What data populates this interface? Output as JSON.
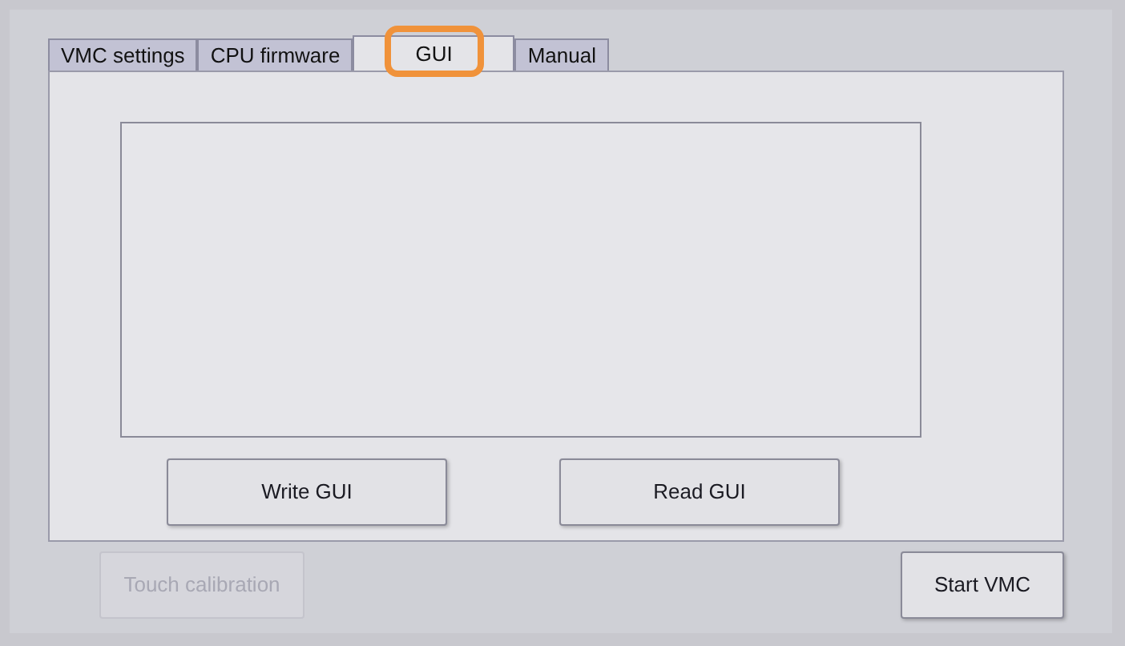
{
  "tabs": [
    {
      "label": "VMC settings",
      "selected": false,
      "highlighted": false
    },
    {
      "label": "CPU firmware",
      "selected": false,
      "highlighted": false
    },
    {
      "label": "GUI",
      "selected": true,
      "highlighted": true
    },
    {
      "label": "Manual",
      "selected": false,
      "highlighted": false
    }
  ],
  "panel": {
    "buttons": [
      {
        "label": "Write GUI",
        "disabled": false
      },
      {
        "label": "Read GUI",
        "disabled": false
      }
    ]
  },
  "footer": {
    "buttons": [
      {
        "label": "Touch calibration",
        "disabled": true
      },
      {
        "label": "Start VMC",
        "disabled": false
      }
    ]
  }
}
